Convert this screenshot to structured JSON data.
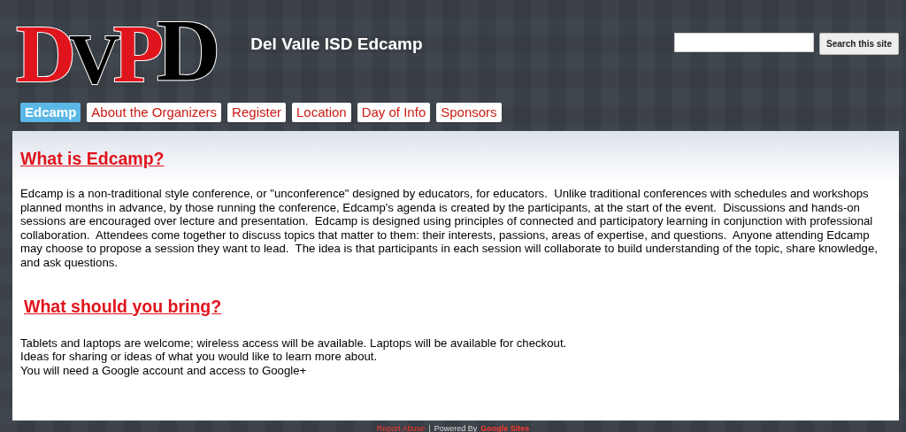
{
  "logo": {
    "letters": [
      {
        "text": "D",
        "color": "#e0141c"
      },
      {
        "text": "V",
        "color": "#000000"
      },
      {
        "text": "P",
        "color": "#e0141c"
      },
      {
        "text": "D",
        "color": "#000000"
      }
    ]
  },
  "site_title": "Del Valle ISD Edcamp",
  "search": {
    "button": "Search this site"
  },
  "nav": [
    {
      "label": "Edcamp",
      "selected": true
    },
    {
      "label": "About the Organizers",
      "selected": false
    },
    {
      "label": "Register",
      "selected": false
    },
    {
      "label": "Location",
      "selected": false
    },
    {
      "label": "Day of Info",
      "selected": false
    },
    {
      "label": "Sponsors",
      "selected": false
    }
  ],
  "sections": [
    {
      "heading": "What is Edcamp?",
      "paragraphs": [
        "Edcamp is a non-traditional style conference, or \"unconference\" designed by educators, for educators.  Unlike traditional conferences with schedules and workshops planned months in advance, by those running the conference, Edcamp's agenda is created by the participants, at the start of the event.  Discussions and hands-on  sessions are encouraged over lecture and presentation.  Edcamp is designed using principles of connected and participatory learning in conjunction with professional collaboration.  Attendees come together to discuss topics that matter to them: their interests, passions, areas of expertise, and questions.  Anyone attending Edcamp may choose to propose a session they want to lead.  The idea is that participants in each session will collaborate to build understanding of the topic, share knowledge, and ask questions."
      ]
    },
    {
      "heading": "What should you bring?",
      "paragraphs": [
        "Tablets and laptops are welcome; wireless access will be available. Laptops will be available for checkout.",
        "Ideas for sharing or ideas of what you would like to learn more about.",
        "You will need a Google account and access to Google+"
      ]
    }
  ],
  "footer": {
    "report": "Report Abuse",
    "separator": "|",
    "powered": "Powered By",
    "sites": "Google Sites"
  }
}
